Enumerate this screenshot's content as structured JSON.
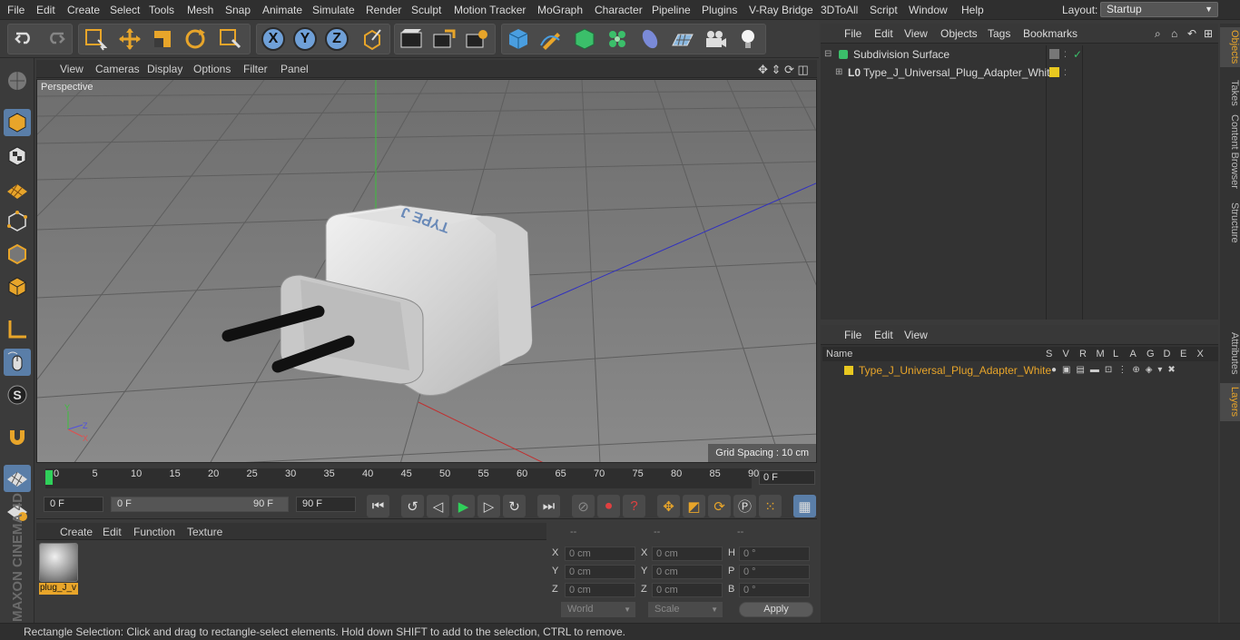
{
  "menubar": {
    "items": [
      "File",
      "Edit",
      "Create",
      "Select",
      "Tools",
      "Mesh",
      "Snap",
      "Animate",
      "Simulate",
      "Render",
      "Sculpt",
      "Motion Tracker",
      "MoGraph",
      "Character",
      "Pipeline",
      "Plugins",
      "V-Ray Bridge",
      "3DToAll",
      "Script",
      "Window",
      "Help"
    ],
    "layout_label": "Layout:",
    "layout_value": "Startup"
  },
  "toolbar": {
    "icons": [
      "undo-icon",
      "redo-icon",
      "rectangle-select-icon",
      "move-icon",
      "scale-icon",
      "rotate-icon",
      "live-select-icon",
      "x-axis-icon",
      "y-axis-icon",
      "z-axis-icon",
      "world-coordinates-icon",
      "render-view-icon",
      "render-picture-viewer-icon",
      "render-settings-icon",
      "cube-icon",
      "pen-icon",
      "subdivision-icon",
      "cloner-icon",
      "deformer-icon",
      "floor-icon",
      "camera-icon",
      "light-icon"
    ],
    "axis_labels": [
      "X",
      "Y",
      "Z"
    ]
  },
  "viewport": {
    "menu": [
      "View",
      "Cameras",
      "Display",
      "Options",
      "Filter",
      "Panel"
    ],
    "label": "Perspective",
    "grid_spacing": "Grid Spacing : 10 cm",
    "product_text": "TYPE J"
  },
  "timeline": {
    "ticks": [
      "0",
      "5",
      "10",
      "15",
      "20",
      "25",
      "30",
      "35",
      "40",
      "45",
      "50",
      "55",
      "60",
      "65",
      "70",
      "75",
      "80",
      "85",
      "90"
    ],
    "current_frame": "0 F",
    "start_field": "0 F",
    "range_start": "0 F",
    "range_end": "90 F",
    "end_field": "90 F"
  },
  "material_manager": {
    "menu": [
      "Create",
      "Edit",
      "Function",
      "Texture"
    ],
    "material_name": "plug_J_v"
  },
  "coordinates": {
    "headers": [
      "--",
      "--",
      "--"
    ],
    "rows": [
      {
        "l1": "X",
        "v1": "0 cm",
        "l2": "X",
        "v2": "0 cm",
        "l3": "H",
        "v3": "0 °"
      },
      {
        "l1": "Y",
        "v1": "0 cm",
        "l2": "Y",
        "v2": "0 cm",
        "l3": "P",
        "v3": "0 °"
      },
      {
        "l1": "Z",
        "v1": "0 cm",
        "l2": "Z",
        "v2": "0 cm",
        "l3": "B",
        "v3": "0 °"
      }
    ],
    "world": "World",
    "scale": "Scale",
    "apply": "Apply"
  },
  "object_manager": {
    "menu": [
      "File",
      "Edit",
      "View",
      "Objects",
      "Tags",
      "Bookmarks"
    ],
    "objects": [
      {
        "name": "Subdivision Surface"
      },
      {
        "name": "Type_J_Universal_Plug_Adapter_White"
      }
    ]
  },
  "layer_manager": {
    "menu": [
      "File",
      "Edit",
      "View"
    ],
    "columns": [
      "Name",
      "S",
      "V",
      "R",
      "M",
      "L",
      "A",
      "G",
      "D",
      "E",
      "X"
    ],
    "layer_name": "Type_J_Universal_Plug_Adapter_White",
    "layer_color": "#e8c820"
  },
  "right_tabs": [
    "Objects",
    "Takes",
    "Content Browser",
    "Structure",
    "Attributes",
    "Layers"
  ],
  "status": "Rectangle Selection: Click and drag to rectangle-select elements. Hold down SHIFT to add to the selection, CTRL to remove.",
  "brand": "MAXON CINEMA 4D",
  "colors": {
    "accent": "#e8a52a",
    "selection_blue": "#6fa0d8",
    "layer_yellow": "#e8c820"
  }
}
